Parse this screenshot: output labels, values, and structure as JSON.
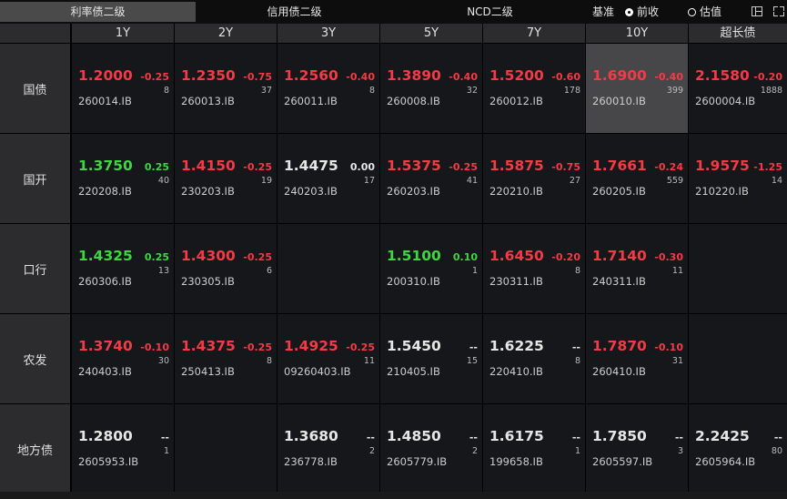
{
  "tabs": [
    "利率债二级",
    "信用债二级",
    "NCD二级"
  ],
  "basis": {
    "label": "基准",
    "options": [
      "前收",
      "估值"
    ],
    "selected": "前收"
  },
  "columns": [
    "1Y",
    "2Y",
    "3Y",
    "5Y",
    "7Y",
    "10Y",
    "超长债"
  ],
  "colors": {
    "up": "#f23b44",
    "down": "#3fd63f",
    "flat": "#e6e6e6",
    "highlight": "#47474a"
  },
  "rows": [
    {
      "label": "国债",
      "cells": [
        {
          "yield": "1.2000",
          "change": "-0.25",
          "count": "8",
          "code": "260014.IB",
          "dir": "red"
        },
        {
          "yield": "1.2350",
          "change": "-0.75",
          "count": "37",
          "code": "260013.IB",
          "dir": "red"
        },
        {
          "yield": "1.2560",
          "change": "-0.40",
          "count": "8",
          "code": "260011.IB",
          "dir": "red"
        },
        {
          "yield": "1.3890",
          "change": "-0.40",
          "count": "32",
          "code": "260008.IB",
          "dir": "red"
        },
        {
          "yield": "1.5200",
          "change": "-0.60",
          "count": "178",
          "code": "260012.IB",
          "dir": "red"
        },
        {
          "yield": "1.6900",
          "change": "-0.40",
          "count": "399",
          "code": "260010.IB",
          "dir": "red",
          "highlight": true
        },
        {
          "yield": "2.1580",
          "change": "-0.20",
          "count": "1888",
          "code": "2600004.IB",
          "dir": "red"
        }
      ]
    },
    {
      "label": "国开",
      "cells": [
        {
          "yield": "1.3750",
          "change": "0.25",
          "count": "40",
          "code": "220208.IB",
          "dir": "green"
        },
        {
          "yield": "1.4150",
          "change": "-0.25",
          "count": "19",
          "code": "230203.IB",
          "dir": "red"
        },
        {
          "yield": "1.4475",
          "change": "0.00",
          "count": "17",
          "code": "240203.IB",
          "dir": "white"
        },
        {
          "yield": "1.5375",
          "change": "-0.25",
          "count": "41",
          "code": "260203.IB",
          "dir": "red"
        },
        {
          "yield": "1.5875",
          "change": "-0.75",
          "count": "27",
          "code": "220210.IB",
          "dir": "red"
        },
        {
          "yield": "1.7661",
          "change": "-0.24",
          "count": "559",
          "code": "260205.IB",
          "dir": "red"
        },
        {
          "yield": "1.9575",
          "change": "-1.25",
          "count": "14",
          "code": "210220.IB",
          "dir": "red"
        }
      ]
    },
    {
      "label": "口行",
      "cells": [
        {
          "yield": "1.4325",
          "change": "0.25",
          "count": "13",
          "code": "260306.IB",
          "dir": "green"
        },
        {
          "yield": "1.4300",
          "change": "-0.25",
          "count": "6",
          "code": "230305.IB",
          "dir": "red"
        },
        null,
        {
          "yield": "1.5100",
          "change": "0.10",
          "count": "1",
          "code": "200310.IB",
          "dir": "green"
        },
        {
          "yield": "1.6450",
          "change": "-0.20",
          "count": "8",
          "code": "230311.IB",
          "dir": "red"
        },
        {
          "yield": "1.7140",
          "change": "-0.30",
          "count": "11",
          "code": "240311.IB",
          "dir": "red"
        },
        null
      ]
    },
    {
      "label": "农发",
      "cells": [
        {
          "yield": "1.3740",
          "change": "-0.10",
          "count": "30",
          "code": "240403.IB",
          "dir": "red"
        },
        {
          "yield": "1.4375",
          "change": "-0.25",
          "count": "8",
          "code": "250413.IB",
          "dir": "red"
        },
        {
          "yield": "1.4925",
          "change": "-0.25",
          "count": "11",
          "code": "09260403.IB",
          "dir": "red"
        },
        {
          "yield": "1.5450",
          "change": "--",
          "count": "15",
          "code": "210405.IB",
          "dir": "white"
        },
        {
          "yield": "1.6225",
          "change": "--",
          "count": "8",
          "code": "220410.IB",
          "dir": "white"
        },
        {
          "yield": "1.7870",
          "change": "-0.10",
          "count": "31",
          "code": "260410.IB",
          "dir": "red"
        },
        null
      ]
    },
    {
      "label": "地方债",
      "cells": [
        {
          "yield": "1.2800",
          "change": "--",
          "count": "1",
          "code": "2605953.IB",
          "dir": "white"
        },
        null,
        {
          "yield": "1.3680",
          "change": "--",
          "count": "2",
          "code": "236778.IB",
          "dir": "white"
        },
        {
          "yield": "1.4850",
          "change": "--",
          "count": "2",
          "code": "2605779.IB",
          "dir": "white"
        },
        {
          "yield": "1.6175",
          "change": "--",
          "count": "1",
          "code": "199658.IB",
          "dir": "white"
        },
        {
          "yield": "1.7850",
          "change": "--",
          "count": "3",
          "code": "2605597.IB",
          "dir": "white"
        },
        {
          "yield": "2.2425",
          "change": "--",
          "count": "80",
          "code": "2605964.IB",
          "dir": "white"
        }
      ]
    }
  ]
}
